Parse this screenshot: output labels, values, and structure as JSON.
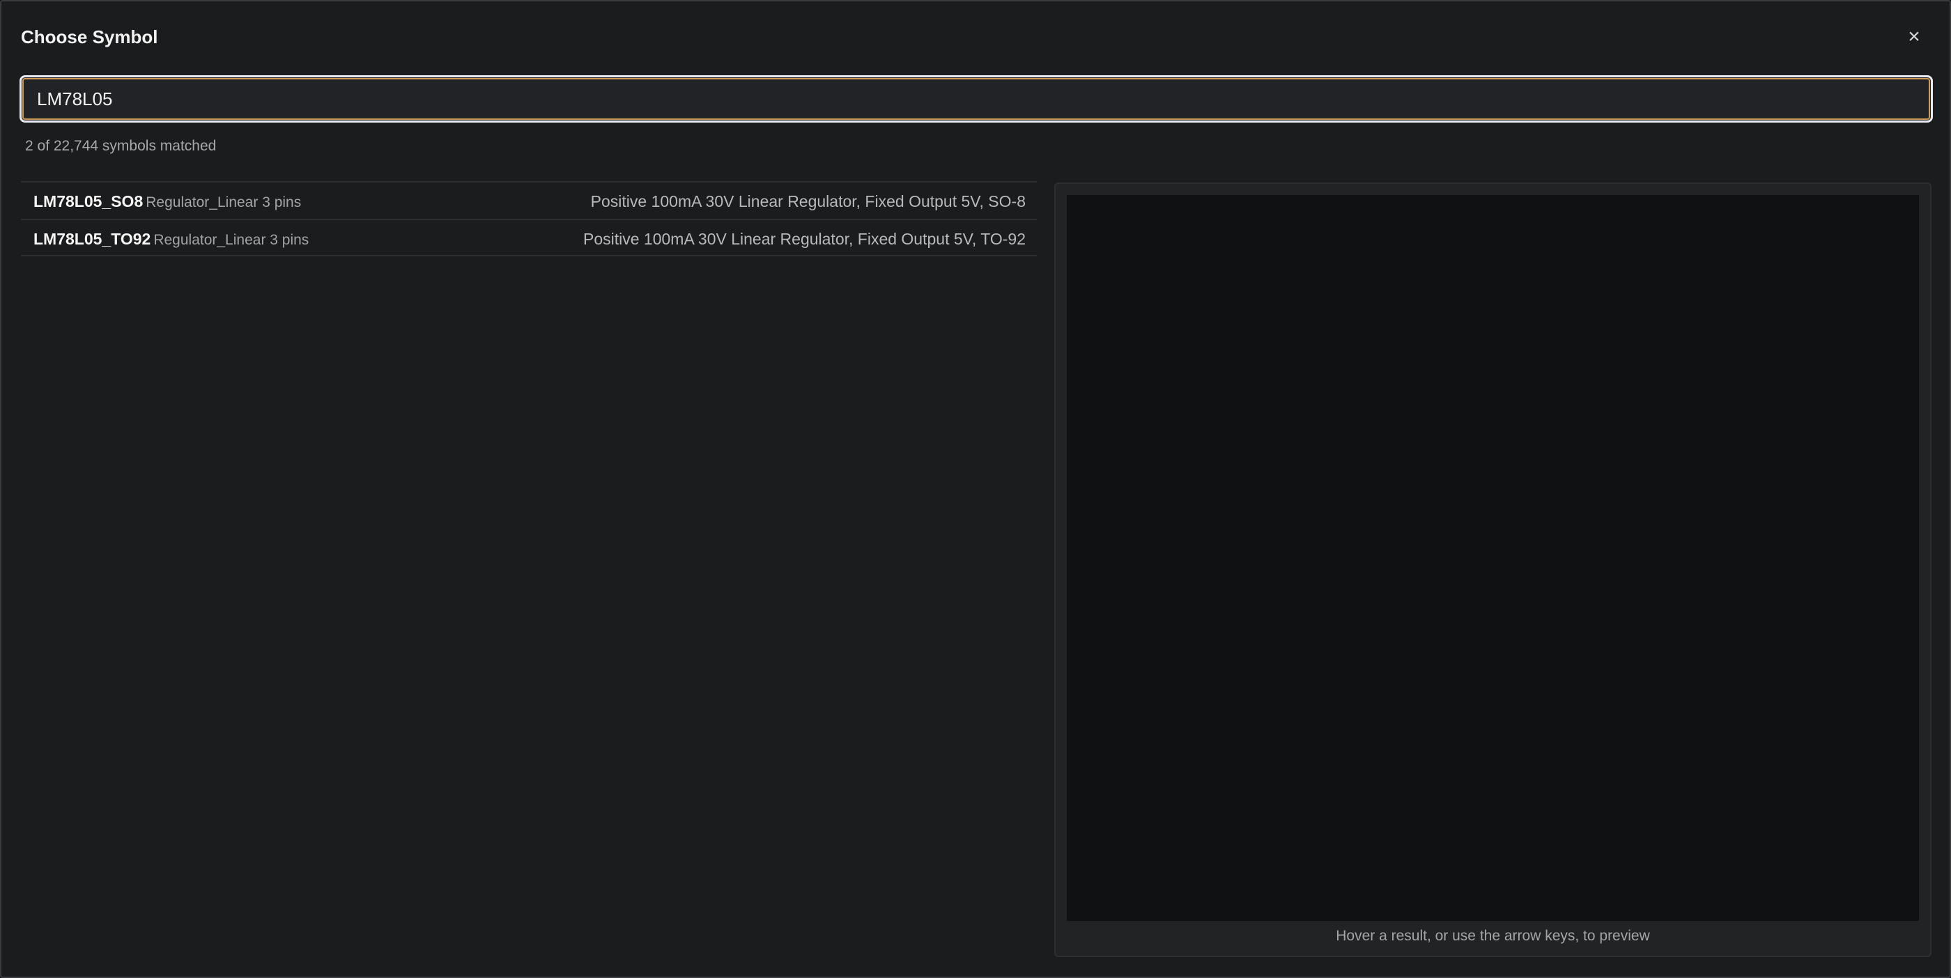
{
  "dialog": {
    "title": "Choose Symbol",
    "close_label": "×"
  },
  "search": {
    "value": "LM78L05",
    "placeholder": ""
  },
  "match_count": "2 of 22,744 symbols matched",
  "results": [
    {
      "name": "LM78L05_SO8",
      "library": "Regulator_Linear 3 pins",
      "description": "Positive 100mA 30V Linear Regulator, Fixed Output 5V, SO-8"
    },
    {
      "name": "LM78L05_TO92",
      "library": "Regulator_Linear 3 pins",
      "description": "Positive 100mA 30V Linear Regulator, Fixed Output 5V, TO-92"
    }
  ],
  "preview": {
    "hint": "Hover a result, or use the arrow keys, to preview"
  },
  "colors": {
    "background": "#1b1c1e",
    "accent_focus": "#c99a55",
    "canvas": "#101113"
  }
}
